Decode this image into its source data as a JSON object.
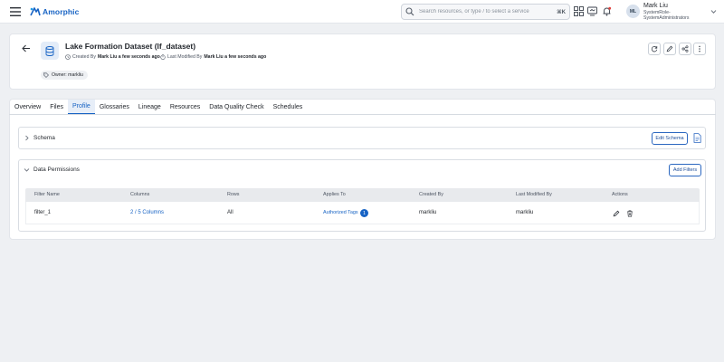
{
  "topbar": {
    "brand": "Amorphic",
    "search_placeholder": "Search resources, or type / to select a service",
    "shortcut": "⌘K",
    "icons": [
      "menu-icon",
      "apps-grid-icon",
      "monitor-icon",
      "bell-icon",
      "chevron-down-icon"
    ],
    "user": {
      "initials": "ML",
      "name": "Mark Liu",
      "role": "SystemRole-SystemAdministrators"
    }
  },
  "dataset": {
    "title": "Lake Formation Dataset (lf_dataset)",
    "created_by_label": "Created By",
    "created_by": "Mark Liu a few seconds ago",
    "modified_by_label": "Last Modified By",
    "modified_by": "Mark Liu a few seconds ago",
    "owner": "Owner: markliu"
  },
  "tabs": [
    "Overview",
    "Files",
    "Profile",
    "Glossaries",
    "Lineage",
    "Resources",
    "Data Quality Check",
    "Schedules"
  ],
  "active_tab": "Profile",
  "schema": {
    "title": "Schema",
    "edit_label": "Edit Schema"
  },
  "permissions": {
    "title": "Data Permissions",
    "add_label": "Add Filters",
    "columns": [
      "Filter Name",
      "Columns",
      "Rows",
      "Applies To",
      "Created By",
      "Last Modified By",
      "Actions"
    ],
    "rows": [
      {
        "filter_name": "filter_1",
        "columns": "2 / 5 Columns",
        "rows": "All",
        "applies_to": "Authorized Tags",
        "applies_count": "1",
        "created_by": "markliu",
        "modified_by": "markliu"
      }
    ]
  },
  "colors": {
    "accent": "#1763c4",
    "background": "#eef0f3",
    "header_row": "#e8eaed"
  }
}
